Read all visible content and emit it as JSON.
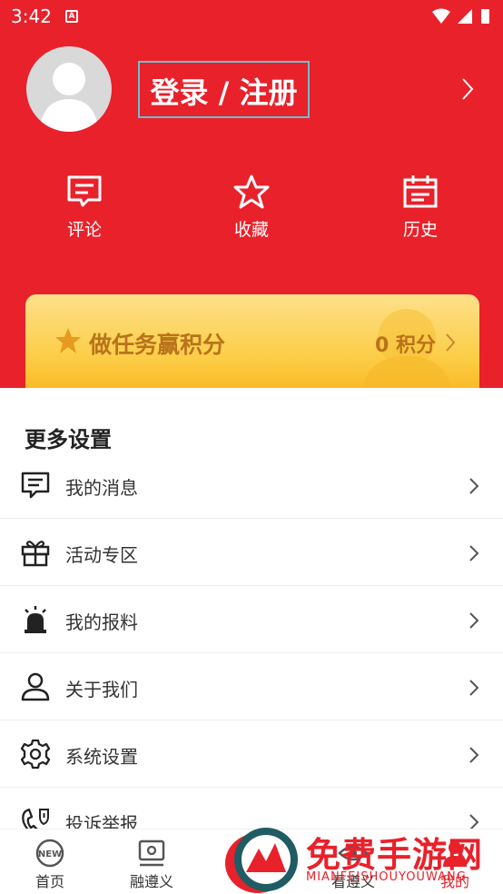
{
  "status_bar": {
    "time": "3:42",
    "notification_icon": "A"
  },
  "header": {
    "login_label": "登录 / 注册",
    "quick_actions": [
      {
        "label": "评论",
        "icon": "comment-icon"
      },
      {
        "label": "收藏",
        "icon": "star-icon"
      },
      {
        "label": "历史",
        "icon": "history-icon"
      }
    ]
  },
  "task_card": {
    "title": "做任务赢积分",
    "points": "0 积分"
  },
  "settings": {
    "title": "更多设置",
    "items": [
      {
        "label": "我的消息",
        "icon": "message-icon"
      },
      {
        "label": "活动专区",
        "icon": "gift-icon"
      },
      {
        "label": "我的报料",
        "icon": "alarm-icon"
      },
      {
        "label": "关于我们",
        "icon": "person-icon"
      },
      {
        "label": "系统设置",
        "icon": "gear-icon"
      },
      {
        "label": "投诉举报",
        "icon": "complaint-icon"
      }
    ]
  },
  "tabbar": {
    "items": [
      {
        "label": "首页",
        "icon": "new-icon"
      },
      {
        "label": "融遵义",
        "icon": "tv-icon"
      },
      {
        "label": "看遵义",
        "icon": "eye-icon"
      },
      {
        "label": "我的",
        "icon": "user-icon"
      }
    ]
  },
  "watermark": {
    "title": "免费手游网",
    "subtitle": "MIANFEISHOUYOUWANG"
  },
  "colors": {
    "brand_red": "#e8212b",
    "gold": "#b9731a"
  }
}
